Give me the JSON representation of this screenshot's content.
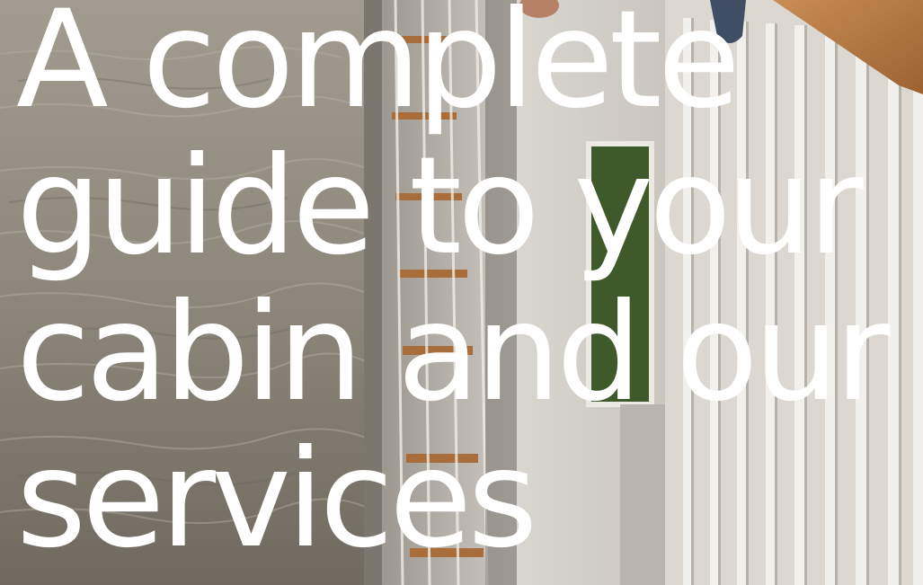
{
  "hero": {
    "headline_lines": [
      "A complete",
      "guide to your",
      "cabin and our",
      "services"
    ]
  },
  "colors": {
    "text": "#ffffff",
    "sea": "#8b857b",
    "railing": "#e9e6e0",
    "handrail_wood": "#b97a43",
    "foliage": "#3e5a2a"
  }
}
